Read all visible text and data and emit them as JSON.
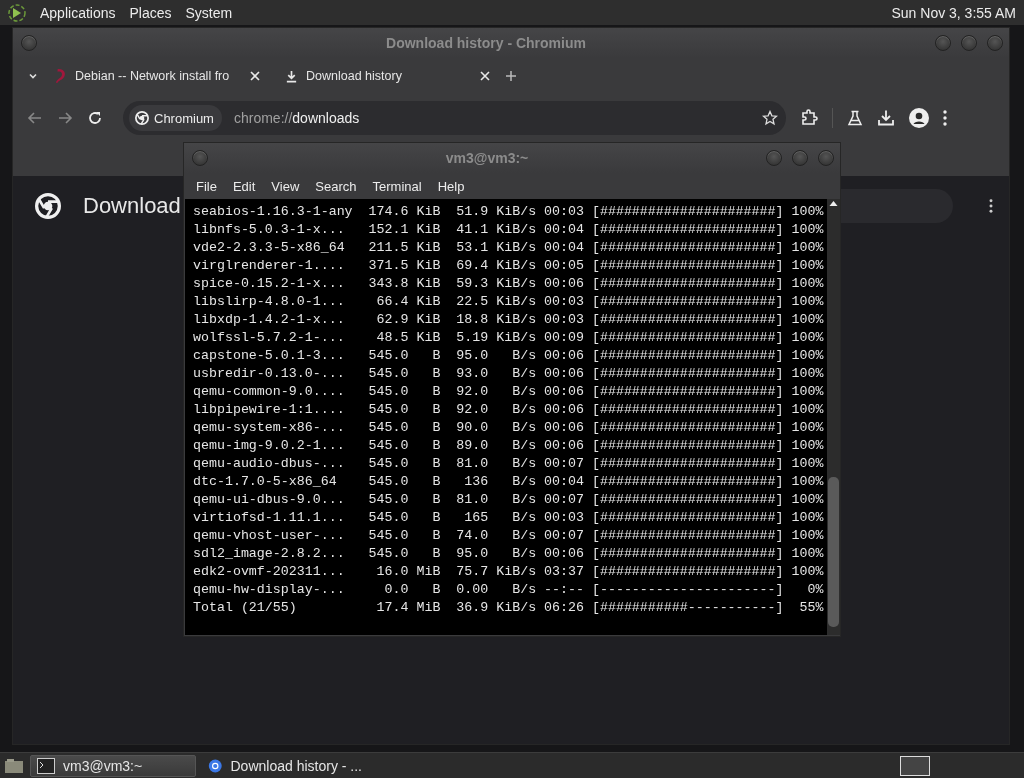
{
  "top_panel": {
    "menus": [
      "Applications",
      "Places",
      "System"
    ],
    "clock": "Sun Nov 3, 3:55 AM"
  },
  "browser": {
    "title": "Download history - Chromium",
    "tabs": [
      {
        "label": "Debian -- Network install fro",
        "kind": "site"
      },
      {
        "label": "Download history",
        "kind": "download"
      }
    ],
    "omnibox": {
      "chip": "Chromium",
      "url_scheme": "chrome://",
      "url_rest": "downloads"
    },
    "page": {
      "heading": "Download"
    }
  },
  "terminal": {
    "title": "vm3@vm3:~",
    "menus": [
      "File",
      "Edit",
      "View",
      "Search",
      "Terminal",
      "Help"
    ],
    "lines": [
      "seabios-1.16.3-1-any  174.6 KiB  51.9 KiB/s 00:03 [######################] 100%",
      "libnfs-5.0.3-1-x...   152.1 KiB  41.1 KiB/s 00:04 [######################] 100%",
      "vde2-2.3.3-5-x86_64   211.5 KiB  53.1 KiB/s 00:04 [######################] 100%",
      "virglrenderer-1....   371.5 KiB  69.4 KiB/s 00:05 [######################] 100%",
      "spice-0.15.2-1-x...   343.8 KiB  59.3 KiB/s 00:06 [######################] 100%",
      "libslirp-4.8.0-1...    66.4 KiB  22.5 KiB/s 00:03 [######################] 100%",
      "libxdp-1.4.2-1-x...    62.9 KiB  18.8 KiB/s 00:03 [######################] 100%",
      "wolfssl-5.7.2-1-...    48.5 KiB  5.19 KiB/s 00:09 [######################] 100%",
      "capstone-5.0.1-3...   545.0   B  95.0   B/s 00:06 [######################] 100%",
      "usbredir-0.13.0-...   545.0   B  93.0   B/s 00:06 [######################] 100%",
      "qemu-common-9.0....   545.0   B  92.0   B/s 00:06 [######################] 100%",
      "libpipewire-1:1....   545.0   B  92.0   B/s 00:06 [######################] 100%",
      "qemu-system-x86-...   545.0   B  90.0   B/s 00:06 [######################] 100%",
      "qemu-img-9.0.2-1...   545.0   B  89.0   B/s 00:06 [######################] 100%",
      "qemu-audio-dbus-...   545.0   B  81.0   B/s 00:07 [######################] 100%",
      "dtc-1.7.0-5-x86_64    545.0   B   136   B/s 00:04 [######################] 100%",
      "qemu-ui-dbus-9.0...   545.0   B  81.0   B/s 00:07 [######################] 100%",
      "virtiofsd-1.11.1...   545.0   B   165   B/s 00:03 [######################] 100%",
      "qemu-vhost-user-...   545.0   B  74.0   B/s 00:07 [######################] 100%",
      "sdl2_image-2.8.2...   545.0   B  95.0   B/s 00:06 [######################] 100%",
      "edk2-ovmf-202311...    16.0 MiB  75.7 KiB/s 03:37 [######################] 100%",
      "qemu-hw-display-...     0.0   B  0.00   B/s --:-- [----------------------]   0%",
      "Total (21/55)          17.4 MiB  36.9 KiB/s 06:26 [###########-----------]  55%"
    ]
  },
  "taskbar": {
    "tasks": [
      {
        "label": "vm3@vm3:~",
        "kind": "terminal",
        "selected": true
      },
      {
        "label": "Download history - ...",
        "kind": "browser",
        "selected": false
      }
    ]
  }
}
